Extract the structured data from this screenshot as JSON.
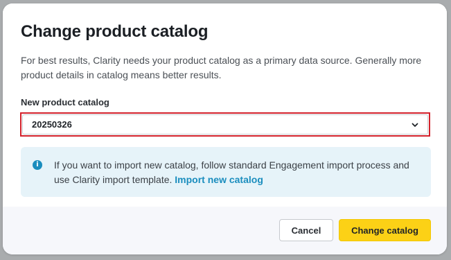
{
  "dialog": {
    "title": "Change product catalog",
    "description": "For best results, Clarity needs your product catalog as a primary data source. Generally more product details in catalog means better results."
  },
  "catalog_field": {
    "label": "New product catalog",
    "selected_value": "20250326",
    "chevron_icon": "chevron-down-icon"
  },
  "info": {
    "icon": "info-icon",
    "icon_glyph": "i",
    "text": "If you want to import new catalog, follow standard Engagement import process and use Clarity import template. ",
    "link_label": "Import new catalog"
  },
  "footer": {
    "cancel_label": "Cancel",
    "confirm_label": "Change catalog"
  },
  "colors": {
    "primary_button": "#fcd116",
    "link": "#1a8dbe",
    "info_background": "#e6f3f9",
    "highlight_border": "#d3212b"
  }
}
